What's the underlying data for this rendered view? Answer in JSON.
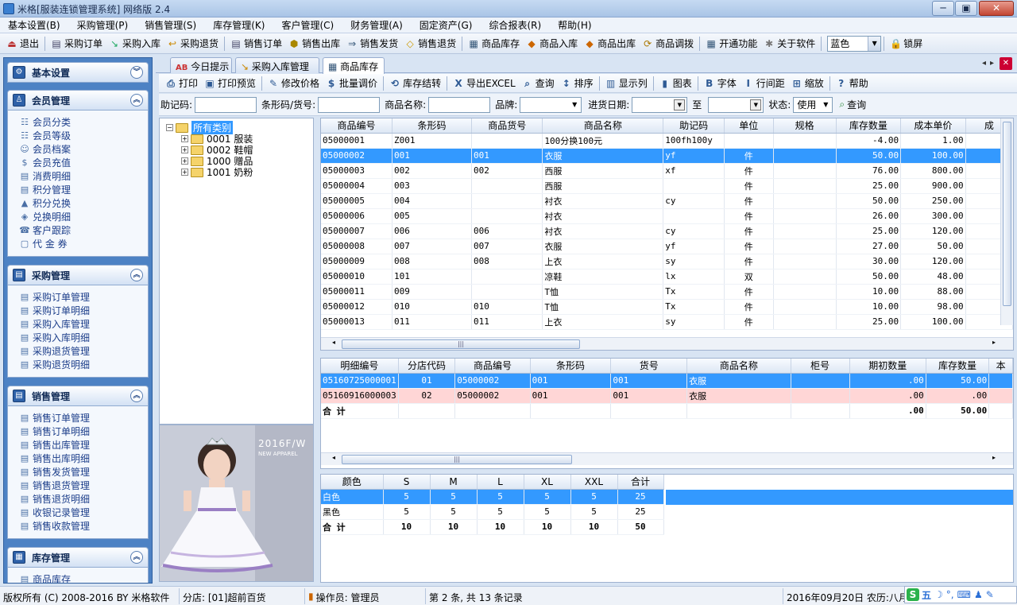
{
  "window": {
    "title": "米格[服装连锁管理系统] 网络版 2.4",
    "minimize": "─",
    "maximize": "▣",
    "close": "✕"
  },
  "menu": [
    "基本设置(B)",
    "采购管理(P)",
    "销售管理(S)",
    "库存管理(K)",
    "客户管理(C)",
    "财务管理(A)",
    "固定资产(G)",
    "综合报表(R)",
    "帮助(H)"
  ],
  "toolbar": {
    "items": [
      {
        "label": "退出",
        "icon": "exit-icon",
        "glyph": "⏏",
        "color": "#b33"
      },
      {
        "label": "采购订单",
        "icon": "purchase-order-icon",
        "glyph": "▤",
        "color": "#446"
      },
      {
        "label": "采购入库",
        "icon": "purchase-in-icon",
        "glyph": "↘",
        "color": "#2a6"
      },
      {
        "label": "采购退货",
        "icon": "purchase-return-icon",
        "glyph": "↩",
        "color": "#c80"
      },
      {
        "label": "销售订单",
        "icon": "sales-order-icon",
        "glyph": "▤",
        "color": "#446"
      },
      {
        "label": "销售出库",
        "icon": "sales-out-icon",
        "glyph": "⬢",
        "color": "#a80"
      },
      {
        "label": "销售发货",
        "icon": "delivery-icon",
        "glyph": "⇒",
        "color": "#357"
      },
      {
        "label": "销售退货",
        "icon": "sales-return-icon",
        "glyph": "◇",
        "color": "#c90"
      },
      {
        "label": "商品库存",
        "icon": "stock-icon",
        "glyph": "▦",
        "color": "#357"
      },
      {
        "label": "商品入库",
        "icon": "goods-in-icon",
        "glyph": "◆",
        "color": "#c60"
      },
      {
        "label": "商品出库",
        "icon": "goods-out-icon",
        "glyph": "◆",
        "color": "#c60"
      },
      {
        "label": "商品调拨",
        "icon": "transfer-icon",
        "glyph": "⟳",
        "color": "#a70"
      },
      {
        "label": "开通功能",
        "icon": "features-icon",
        "glyph": "▦",
        "color": "#357"
      },
      {
        "label": "关于软件",
        "icon": "about-icon",
        "glyph": "✱",
        "color": "#777"
      }
    ],
    "theme": "蓝色",
    "lock": "锁屏"
  },
  "sidebar": {
    "sections": [
      {
        "title": "基本设置",
        "toggle": "︾",
        "items": []
      },
      {
        "title": "会员管理",
        "toggle": "︽",
        "items": [
          "会员分类",
          "会员等级",
          "会员档案",
          "会员充值",
          "消费明细",
          "积分管理",
          "积分兑换",
          "兑换明细",
          "客户跟踪",
          "代 金 券"
        ]
      },
      {
        "title": "采购管理",
        "toggle": "︽",
        "items": [
          "采购订单管理",
          "采购订单明细",
          "采购入库管理",
          "采购入库明细",
          "采购退货管理",
          "采购退货明细"
        ]
      },
      {
        "title": "销售管理",
        "toggle": "︽",
        "items": [
          "销售订单管理",
          "销售订单明细",
          "销售出库管理",
          "销售出库明细",
          "销售发货管理",
          "销售退货管理",
          "销售退货明细",
          "收银记录管理",
          "销售收款管理"
        ]
      },
      {
        "title": "库存管理",
        "toggle": "︽",
        "items": [
          "商品库存"
        ]
      }
    ]
  },
  "tabs": [
    "今日提示",
    "采购入库管理",
    "商品库存"
  ],
  "tab_nav": {
    "prev": "◂",
    "next": "▸",
    "close": "✕"
  },
  "actions": [
    {
      "label": "打印",
      "icon": "print-icon",
      "glyph": "⎙"
    },
    {
      "label": "打印预览",
      "icon": "print-preview-icon",
      "glyph": "▣"
    },
    {
      "label": "修改价格",
      "icon": "edit-price-icon",
      "glyph": "✎"
    },
    {
      "label": "批量调价",
      "icon": "batch-price-icon",
      "glyph": "$"
    },
    {
      "label": "库存结转",
      "icon": "stock-carryover-icon",
      "glyph": "⟲"
    },
    {
      "label": "导出EXCEL",
      "icon": "excel-icon",
      "glyph": "X"
    },
    {
      "label": "查询",
      "icon": "query-icon",
      "glyph": "⌕"
    },
    {
      "label": "排序",
      "icon": "sort-icon",
      "glyph": "↕"
    },
    {
      "label": "显示列",
      "icon": "columns-icon",
      "glyph": "▥"
    },
    {
      "label": "图表",
      "icon": "chart-icon",
      "glyph": "▮"
    },
    {
      "label": "字体",
      "icon": "font-icon",
      "glyph": "B"
    },
    {
      "label": "行间距",
      "icon": "row-spacing-icon",
      "glyph": "I"
    },
    {
      "label": "缩放",
      "icon": "zoom-icon",
      "glyph": "⊞"
    },
    {
      "label": "帮助",
      "icon": "help-icon",
      "glyph": "?"
    }
  ],
  "filter": {
    "mnemonic_label": "助记码:",
    "barcode_label": "条形码/货号:",
    "name_label": "商品名称:",
    "brand_label": "品牌:",
    "date_label": "进货日期:",
    "to_label": "至",
    "status_label": "状态:",
    "status_value": "使用",
    "query": "查询"
  },
  "tree": {
    "root": "所有类别",
    "nodes": [
      "0001  服装",
      "0002  鞋帽",
      "1000  赠品",
      "1001  奶粉"
    ]
  },
  "photo": {
    "stamp": "2016F/W",
    "tag": "NEW APPAREL"
  },
  "stock_grid": {
    "columns": [
      "商品编号",
      "条形码",
      "商品货号",
      "商品名称",
      "助记码",
      "单位",
      "规格",
      "库存数量",
      "成本单价",
      "成"
    ],
    "rows": [
      [
        "05000001",
        "Z001",
        "",
        "100分换100元",
        "100fh100y",
        "",
        "",
        "-4.00",
        "1.00"
      ],
      [
        "05000002",
        "001",
        "001",
        "衣服",
        "yf",
        "件",
        "",
        "50.00",
        "100.00"
      ],
      [
        "05000003",
        "002",
        "002",
        "西服",
        "xf",
        "件",
        "",
        "76.00",
        "800.00"
      ],
      [
        "05000004",
        "003",
        "",
        "西服",
        "",
        "件",
        "",
        "25.00",
        "900.00"
      ],
      [
        "05000005",
        "004",
        "",
        "衬衣",
        "cy",
        "件",
        "",
        "50.00",
        "250.00"
      ],
      [
        "05000006",
        "005",
        "",
        "衬衣",
        "",
        "件",
        "",
        "26.00",
        "300.00"
      ],
      [
        "05000007",
        "006",
        "006",
        "衬衣",
        "cy",
        "件",
        "",
        "25.00",
        "120.00"
      ],
      [
        "05000008",
        "007",
        "007",
        "衣服",
        "yf",
        "件",
        "",
        "27.00",
        "50.00"
      ],
      [
        "05000009",
        "008",
        "008",
        "上衣",
        "sy",
        "件",
        "",
        "30.00",
        "120.00"
      ],
      [
        "05000010",
        "101",
        "",
        "凉鞋",
        "lx",
        "双",
        "",
        "50.00",
        "48.00"
      ],
      [
        "05000011",
        "009",
        "",
        "T恤",
        "Tx",
        "件",
        "",
        "10.00",
        "88.00"
      ],
      [
        "05000012",
        "010",
        "010",
        "T恤",
        "Tx",
        "件",
        "",
        "10.00",
        "98.00"
      ],
      [
        "05000013",
        "011",
        "011",
        "上衣",
        "sy",
        "件",
        "",
        "25.00",
        "100.00"
      ]
    ]
  },
  "detail_grid": {
    "columns": [
      "明细编号",
      "分店代码",
      "商品编号",
      "条形码",
      "货号",
      "商品名称",
      "柜号",
      "期初数量",
      "库存数量",
      "本"
    ],
    "rows": [
      [
        "05160725000001",
        "01",
        "05000002",
        "001",
        "001",
        "衣服",
        "",
        ".00",
        "50.00"
      ],
      [
        "05160916000003",
        "02",
        "05000002",
        "001",
        "001",
        "衣服",
        "",
        ".00",
        ".00"
      ]
    ],
    "total": [
      "合  计",
      "",
      "",
      "",
      "",
      "",
      "",
      ".00",
      "50.00"
    ]
  },
  "size_grid": {
    "columns": [
      "颜色",
      "S",
      "M",
      "L",
      "XL",
      "XXL",
      "合计"
    ],
    "rows": [
      [
        "白色",
        "5",
        "5",
        "5",
        "5",
        "5",
        "25"
      ],
      [
        "黑色",
        "5",
        "5",
        "5",
        "5",
        "5",
        "25"
      ]
    ],
    "total": [
      "合  计",
      "10",
      "10",
      "10",
      "10",
      "10",
      "50"
    ]
  },
  "status": {
    "copyright": "版权所有 (C) 2008-2016 BY 米格软件",
    "store": "分店: [01]超前百货",
    "operator": "操作员: 管理员",
    "records": "第 2 条, 共 13 条记录",
    "date": "2016年09月20日  农历:八月"
  },
  "ime": {
    "logo": "S",
    "lang": "五"
  },
  "colors": {
    "selected_row": "#3399ff",
    "pink_row": "#ffd6d6",
    "sidebar_bg": "#4d82c4"
  }
}
